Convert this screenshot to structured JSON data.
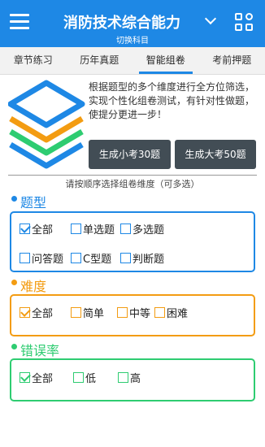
{
  "header": {
    "title": "消防技术综合能力",
    "subtitle": "切换科目",
    "menu_icon": "hamburger-menu-icon",
    "switch_icon": "chevron-down-icon",
    "apps_icon": "grid-apps-icon"
  },
  "tabs": [
    {
      "label": "章节练习",
      "active": false
    },
    {
      "label": "历年真题",
      "active": false
    },
    {
      "label": "智能组卷",
      "active": true
    },
    {
      "label": "考前押题",
      "active": false
    }
  ],
  "intro": {
    "description": "根据题型的多个维度进行全方位筛选，实现个性化组卷测试，有针对性做题，使提分更进一步！",
    "small_exam_button": "生成小考30题",
    "big_exam_button": "生成大考50题",
    "hint": "请按顺序选择组卷维度（可多选）"
  },
  "sections": {
    "type": {
      "title": "题型",
      "color": "#1e88e5",
      "options": [
        {
          "label": "全部",
          "checked": true
        },
        {
          "label": "单选题",
          "checked": false
        },
        {
          "label": "多选题",
          "checked": false
        },
        {
          "label": "问答题",
          "checked": false
        },
        {
          "label": "C型题",
          "checked": false
        },
        {
          "label": "判断题",
          "checked": false
        }
      ]
    },
    "difficulty": {
      "title": "难度",
      "color": "#f39c12",
      "options": [
        {
          "label": "全部",
          "checked": true
        },
        {
          "label": "简单",
          "checked": false
        },
        {
          "label": "中等",
          "checked": false
        },
        {
          "label": "困难",
          "checked": false
        }
      ]
    },
    "error_rate": {
      "title": "错误率",
      "color": "#2ecc71",
      "options": [
        {
          "label": "全部",
          "checked": true
        },
        {
          "label": "低",
          "checked": false
        },
        {
          "label": "高",
          "checked": false
        }
      ]
    }
  },
  "colors": {
    "brand": "#1e88e5",
    "button_dark": "#424d55"
  }
}
